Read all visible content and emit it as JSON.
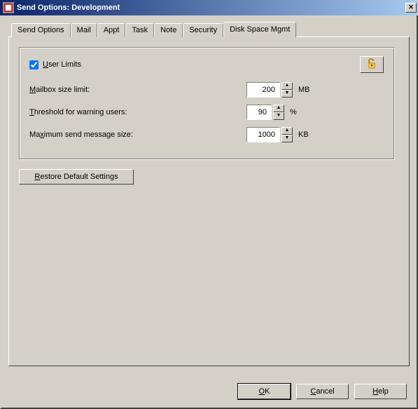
{
  "window": {
    "title": "Send Options:  Development"
  },
  "tabs": {
    "sendOptions": "Send Options",
    "mail": "Mail",
    "appt": "Appt",
    "task": "Task",
    "note": "Note",
    "security": "Security",
    "diskSpace": "Disk Space Mgmt"
  },
  "diskSpace": {
    "userLimitsLabel": "User Limits",
    "userLimitsChecked": true,
    "lockIcon": "lock-open-icon",
    "mailboxSizeLabel_pre": "M",
    "mailboxSizeLabel_post": "ailbox size limit:",
    "mailboxSizeValue": "200",
    "mailboxSizeUnit": "MB",
    "thresholdLabel_pre": "T",
    "thresholdLabel_post": "hreshold for warning users:",
    "thresholdValue": "90",
    "thresholdUnit": "%",
    "maxSendLabel_pre": "Ma",
    "maxSendLabel_u": "x",
    "maxSendLabel_post": "imum send message size:",
    "maxSendValue": "1000",
    "maxSendUnit": "KB",
    "restoreLabel_pre": "R",
    "restoreLabel_post": "estore Default Settings"
  },
  "buttons": {
    "ok_u": "O",
    "ok_post": "K",
    "cancel_u": "C",
    "cancel_post": "ancel",
    "help_u": "H",
    "help_post": "elp"
  }
}
